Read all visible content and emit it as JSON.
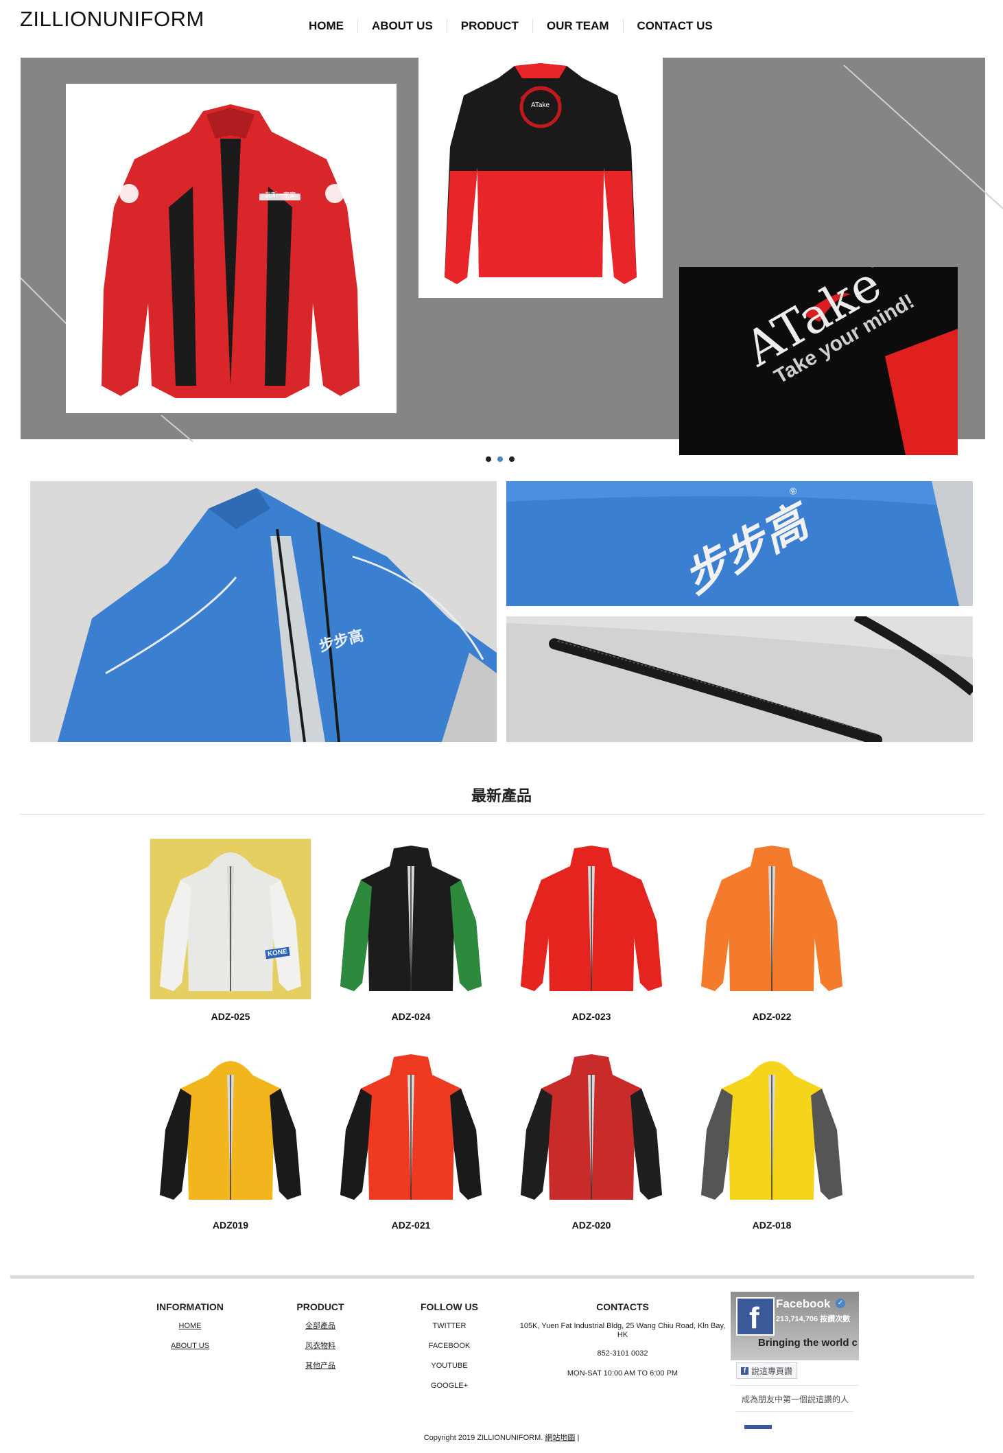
{
  "site": {
    "logo": "ZILLIONUNIFORM"
  },
  "nav": {
    "items": [
      "HOME",
      "ABOUT US",
      "PRODUCT",
      "OUR TEAM",
      "CONTACT US"
    ]
  },
  "hero": {
    "card1_text": "瓦斯一家家",
    "card2_text": "ATake",
    "card3_brand": "ATake",
    "card3_mark": "®",
    "card3_tagline": "Take your mind!",
    "dots": 3,
    "active_dot": 1
  },
  "gallery": {
    "brand_text": "步步高",
    "mark": "®"
  },
  "latest": {
    "title": "最新產品",
    "products": [
      {
        "code": "ADZ-025",
        "color": "#e8e8e4",
        "accent": "#f1f1ef",
        "bg": "#e6cf61",
        "logo": "KONE"
      },
      {
        "code": "ADZ-024",
        "color": "#1c1c1c",
        "accent": "#2d8a3c",
        "bg": "#ffffff"
      },
      {
        "code": "ADZ-023",
        "color": "#e5241f",
        "accent": "#e5241f",
        "bg": "#ffffff"
      },
      {
        "code": "ADZ-022",
        "color": "#f47a2c",
        "accent": "#f47a2c",
        "bg": "#ffffff"
      },
      {
        "code": "ADZ019",
        "color": "#f2b51e",
        "accent": "#1a1a1a",
        "bg": "#ffffff"
      },
      {
        "code": "ADZ-021",
        "color": "#ef3a22",
        "accent": "#1a1a1a",
        "bg": "#ffffff"
      },
      {
        "code": "ADZ-020",
        "color": "#c92b2b",
        "accent": "#1f1f1f",
        "bg": "#ffffff"
      },
      {
        "code": "ADZ-018",
        "color": "#f5d51c",
        "accent": "#555555",
        "bg": "#ffffff"
      }
    ]
  },
  "footer": {
    "information": {
      "title": "INFORMATION",
      "links": [
        "HOME",
        "ABOUT US"
      ]
    },
    "product": {
      "title": "PRODUCT",
      "links": [
        "全部產品",
        "风衣物料",
        "其他产品"
      ]
    },
    "follow": {
      "title": "FOLLOW US",
      "links": [
        "TWITTER",
        "FACEBOOK",
        "YOUTUBE",
        "GOOGLE+"
      ]
    },
    "contacts": {
      "title": "CONTACTS",
      "address": "105K, Yuen Fat Industrial Bldg, 25 Wang Chiu Road, Kln Bay, HK",
      "phone": "852-3101 0032",
      "hours": "MON-SAT 10:00 AM TO 6:00 PM"
    },
    "facebook": {
      "name": "Facebook",
      "likes": "213,714,706 按讚次數",
      "tagline": "Bringing the world c",
      "like_button": "說這專頁讚",
      "friends_text": "成為朋友中第一個說這讚的人"
    },
    "copyright": "Copyright 2019 ZILLIONUNIFORM.",
    "sitemap": "網站地圖",
    "separator": "|"
  },
  "colors": {
    "slider_bg": "#858585",
    "accent_blue": "#4a86c6",
    "jacket_blue": "#3b7fd0"
  }
}
